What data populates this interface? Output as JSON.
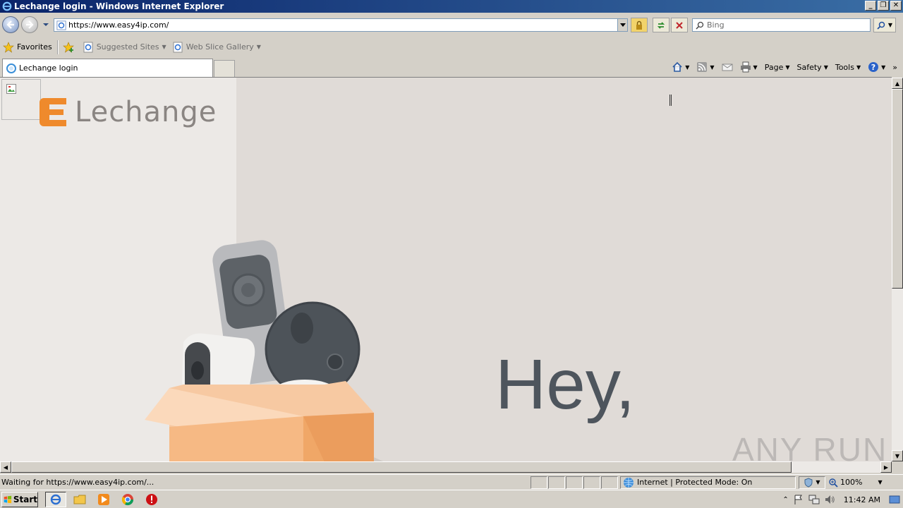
{
  "window": {
    "title": "Lechange login - Windows Internet Explorer",
    "controls": [
      "minimize",
      "restore",
      "close"
    ]
  },
  "address_bar": {
    "url": "https://www.easy4ip.com/",
    "search_placeholder": "Bing"
  },
  "favorites_bar": {
    "favorites_label": "Favorites",
    "items": [
      {
        "label": "Suggested Sites"
      },
      {
        "label": "Web Slice Gallery"
      }
    ]
  },
  "tabs": [
    {
      "label": "Lechange login"
    }
  ],
  "command_bar": {
    "page_label": "Page",
    "safety_label": "Safety",
    "tools_label": "Tools"
  },
  "page": {
    "logo_text": "Lechange",
    "greeting": "Hey,",
    "watermark": "ANY RUN",
    "colors": {
      "brand": "#ef8a2c",
      "text": "#4e555d"
    }
  },
  "status_bar": {
    "text": "Waiting for https://www.easy4ip.com/...",
    "zone": "Internet | Protected Mode: On",
    "zoom": "100%"
  },
  "taskbar": {
    "start_label": "Start",
    "clock": "11:42 AM"
  }
}
